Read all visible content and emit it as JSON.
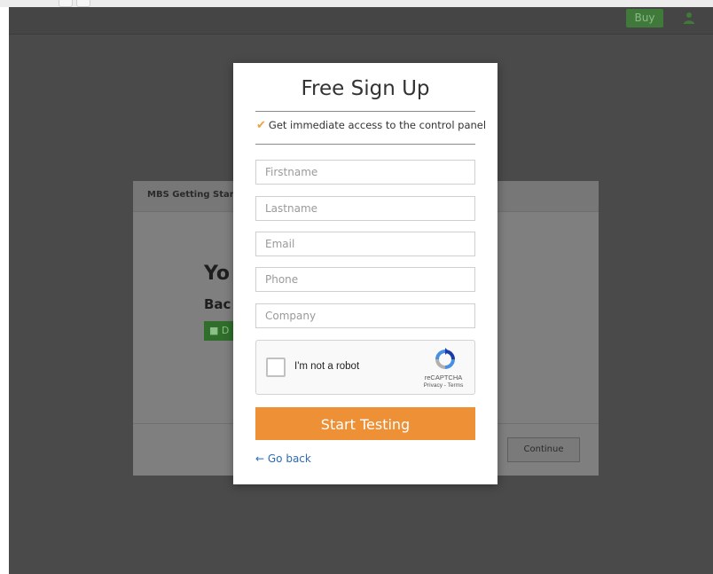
{
  "header": {
    "buy_label": "Buy",
    "user_icon": "user-icon"
  },
  "background_dialog": {
    "title": "MBS Getting Start",
    "heading_1": "Yo",
    "heading_2": "Bac",
    "green_button_label": "D",
    "continue_label": "Continue"
  },
  "signup": {
    "title": "Free Sign Up",
    "benefit": "Get immediate access to the control panel",
    "benefit_icon": "checkmark-icon",
    "fields": {
      "firstname_placeholder": "Firstname",
      "lastname_placeholder": "Lastname",
      "email_placeholder": "Email",
      "phone_placeholder": "Phone",
      "company_placeholder": "Company"
    },
    "captcha": {
      "label": "I'm not a robot",
      "brand": "reCAPTCHA",
      "links": "Privacy - Terms"
    },
    "submit_label": "Start Testing",
    "go_back_label": "← Go back"
  },
  "colors": {
    "accent_orange": "#ee9035",
    "link_blue": "#2c6cb0",
    "check_orange": "#f0a23a",
    "overlay": "#4a4a4a"
  }
}
